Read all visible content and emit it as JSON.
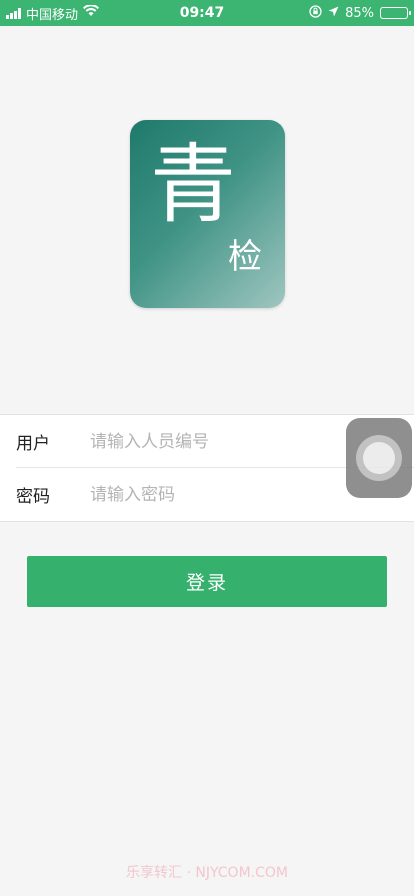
{
  "status_bar": {
    "carrier": "中国移动",
    "time": "09:47",
    "battery": "85%",
    "battery_level": 0.85,
    "icons": [
      "signal-icon",
      "wifi-icon",
      "lock-rotation-icon",
      "location-arrow-icon",
      "battery-icon"
    ]
  },
  "logo": {
    "main_char": "青",
    "sub_char": "检"
  },
  "form": {
    "user_label": "用户",
    "user_placeholder": "请输入人员编号",
    "password_label": "密码",
    "password_placeholder": "请输入密码"
  },
  "login_button": "登录",
  "watermark": "乐享转汇 · NJYCOM.COM",
  "colors": {
    "status_bar": "#3cb572",
    "login_button": "#35b06d",
    "logo_gradient_start": "#1f7a6c",
    "logo_gradient_end": "#9fc6c0"
  }
}
